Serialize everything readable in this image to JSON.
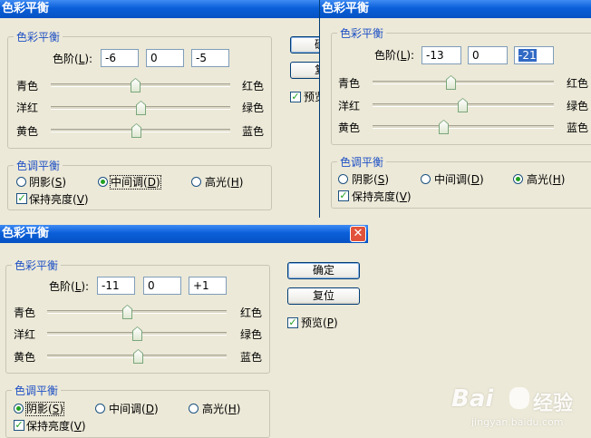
{
  "title": "色彩平衡",
  "close_icon": "✕",
  "color_group": "色彩平衡",
  "levels_label_pre": "色阶(",
  "levels_label_key": "L",
  "levels_label_post": "):",
  "sliders": {
    "cyan": "青色",
    "red": "红色",
    "magenta": "洋红",
    "green": "绿色",
    "yellow": "黄色",
    "blue": "蓝色"
  },
  "tone_group": "色调平衡",
  "shadows": {
    "pre": "阴影(",
    "key": "S",
    "post": ")"
  },
  "midtones": {
    "pre": "中间调(",
    "key": "D",
    "post": ")"
  },
  "highlights": {
    "pre": "高光(",
    "key": "H",
    "post": ")"
  },
  "preserve": {
    "pre": "保持亮度(",
    "key": "V",
    "post": ")"
  },
  "preview": {
    "pre": "预览(",
    "key": "P",
    "post": ")",
    "short": "预览"
  },
  "ok_button": "确定",
  "reset_button": "复位",
  "ok_button_partial": "确",
  "reset_button_partial": "复",
  "dialog1": {
    "levels": [
      "-6",
      "0",
      "-5"
    ],
    "slider_levels": [
      -6,
      0,
      -5
    ],
    "tone": "midtones",
    "preserve_checked": true,
    "preview_checked": true
  },
  "dialog2": {
    "levels": [
      "-13",
      "0",
      "-21"
    ],
    "slider_levels": [
      -13,
      0,
      -21
    ],
    "tone": "highlights",
    "preserve_checked": true
  },
  "dialog3": {
    "levels": [
      "-11",
      "0",
      "+1"
    ],
    "slider_levels": [
      -11,
      0,
      1
    ],
    "tone": "shadows",
    "preserve_checked": true,
    "preview_checked": true
  },
  "watermark": {
    "logo": "Bai",
    "text": "经验",
    "url": "jingyan.baidu.com"
  }
}
